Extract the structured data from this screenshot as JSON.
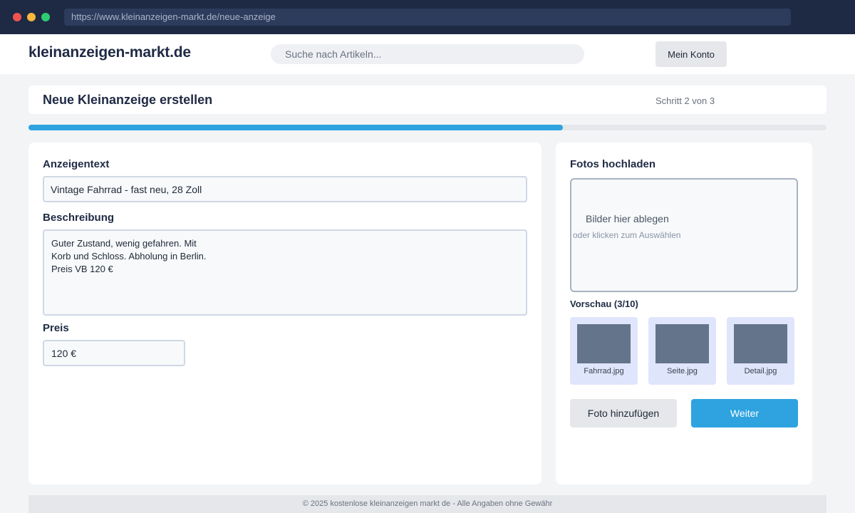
{
  "browser": {
    "url": "https://www.kleinanzeigen-markt.de/neue-anzeige"
  },
  "header": {
    "logo": "kleinanzeigen-markt.de",
    "search_placeholder": "Suche nach Artikeln...",
    "account_label": "Mein Konto"
  },
  "page": {
    "title": "Neue Kleinanzeige erstellen",
    "step_text": "Schritt 2 von 3",
    "progress_fraction": 0.67
  },
  "form": {
    "title_label": "Anzeigentext",
    "title_value": "Vintage Fahrrad - fast neu, 28 Zoll",
    "description_label": "Beschreibung",
    "description_value": "Guter Zustand, wenig gefahren. Mit\nKorb und Schloss. Abholung in Berlin.\nPreis VB 120 €",
    "price_label": "Preis",
    "price_value": "120 €"
  },
  "upload": {
    "heading": "Fotos hochladen",
    "drop_title": "Bilder hier ablegen",
    "drop_subtitle": "oder klicken zum Auswählen",
    "preview_label": "Vorschau (3/10)",
    "thumbnails": [
      {
        "name": "Fahrrad.jpg"
      },
      {
        "name": "Seite.jpg"
      },
      {
        "name": "Detail.jpg"
      }
    ],
    "add_photo_label": "Foto hinzufügen",
    "next_label": "Weiter"
  },
  "footer": {
    "text": "© 2025 kostenlose kleinanzeigen markt de - Alle Angaben ohne Gewähr"
  },
  "colors": {
    "accent": "#2ea3e0",
    "chrome": "#1e2a44",
    "thumbnail_bg": "#dfe5fb"
  }
}
